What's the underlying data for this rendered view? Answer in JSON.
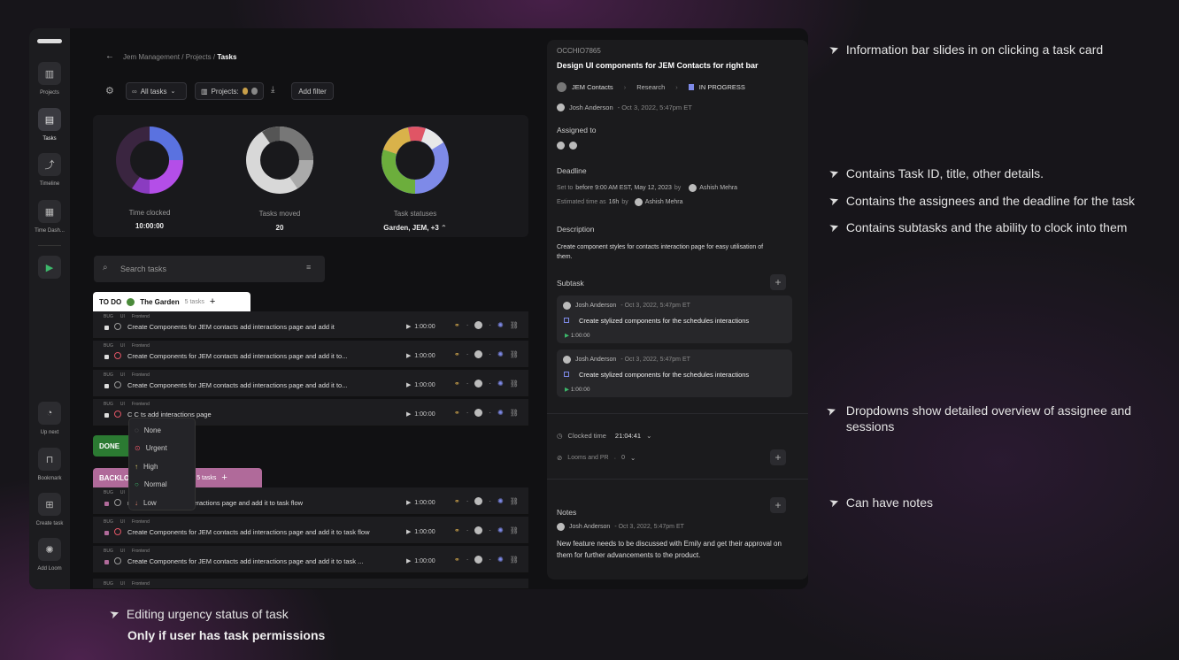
{
  "sidebar": {
    "items": [
      {
        "label": "Projects"
      },
      {
        "label": "Tasks"
      },
      {
        "label": "Timeline"
      },
      {
        "label": "Time Dash..."
      },
      {
        "label": "Up next"
      },
      {
        "label": "Bookmark"
      },
      {
        "label": "Create task"
      },
      {
        "label": "Add Loom"
      }
    ]
  },
  "breadcrumb": {
    "a": "Jem Management",
    "sep": "/",
    "b": "Projects",
    "c": "Tasks"
  },
  "toolbar": {
    "all_tasks": "All tasks",
    "projects": "Projects:",
    "add_filter": "Add filter"
  },
  "stats": [
    {
      "label": "Time clocked",
      "value": "10:00:00"
    },
    {
      "label": "Tasks moved",
      "value": "20"
    },
    {
      "label": "Task statuses",
      "value": "Garden, JEM, +3"
    }
  ],
  "search": {
    "placeholder": "Search tasks"
  },
  "groups": {
    "todo": {
      "status": "TO DO",
      "project": "The Garden",
      "count": "5 tasks"
    },
    "done": {
      "status": "DONE"
    },
    "backlog": {
      "status": "BACKLO",
      "project": "a",
      "count": "5 tasks"
    }
  },
  "tags": {
    "bug": "BUG",
    "ui": "UI",
    "frontend": "Frontend"
  },
  "tasks": [
    {
      "title": "Create Components for JEM contacts add interactions page and add it",
      "time": "1:00:00"
    },
    {
      "title": "Create Components for JEM contacts add interactions page and add it to...",
      "time": "1:00:00"
    },
    {
      "title": "Create Components for JEM contacts add interactions page and add it to...",
      "time": "1:00:00"
    },
    {
      "title": "C   C             ts add interactions page",
      "time": "1:00:00"
    },
    {
      "title": "r JEM contacts add interactions page and add it to task flow",
      "time": "1:00:00"
    },
    {
      "title": "Create Components for JEM contacts add interactions page and add it to task flow",
      "time": "1:00:00"
    },
    {
      "title": "Create Components for JEM contacts add interactions page and add it to task ...",
      "time": "1:00:00"
    }
  ],
  "urgency": {
    "options": [
      "None",
      "Urgent",
      "High",
      "Normal",
      "Low"
    ],
    "colors": [
      "#888888",
      "#e05565",
      "#d8c86a",
      "#3db86b",
      "#d8806a"
    ]
  },
  "panel": {
    "task_id": "OCCHIO7865",
    "title": "Design UI components for JEM Contacts for right bar",
    "project": "JEM Contacts",
    "list": "Research",
    "status": "IN PROGRESS",
    "creator": "Josh Anderson",
    "created": "- Oct 3, 2022, 5:47pm ET",
    "assigned_label": "Assigned to",
    "deadline_label": "Deadline",
    "deadline_prefix": "Set to",
    "deadline_value": "before 9:00 AM EST, May 12, 2023",
    "by": "by",
    "deadline_person": "Ashish Mehra",
    "estimate_prefix": "Estimated time as",
    "estimate_value": "16h",
    "description_label": "Description",
    "description": "Create component styles for contacts interaction page for easy utilisation of them.",
    "subtask_label": "Subtask",
    "subtasks": [
      {
        "author": "Josh Anderson",
        "date": "- Oct 3, 2022, 5:47pm ET",
        "title": "Create stylized components for the schedules interactions",
        "time": "1:00:00"
      },
      {
        "author": "Josh Anderson",
        "date": "- Oct 3, 2022, 5:47pm ET",
        "title": "Create stylized components for the schedules interactions",
        "time": "1:00:00"
      }
    ],
    "clocked_label": "Clocked time",
    "clocked_value": "21:04:41",
    "looms_label": "Looms and PR",
    "looms_value": "0",
    "notes_label": "Notes",
    "note_author": "Josh Anderson",
    "note_date": "- Oct 3, 2022, 5:47pm ET",
    "note_text": "New feature needs to be discussed with Emily and get their approval on them for further advancements to the product."
  },
  "annotations": [
    "Information bar slides in on clicking a task card",
    "Contains Task ID, title, other details.",
    "Contains the assignees and the deadline for the task",
    "Contains subtasks and the ability to clock into them",
    "Dropdowns show detailed overview of assignee and sessions",
    "Can have notes"
  ],
  "caption": {
    "line1": "Editing urgency status of task",
    "line2": "Only if user has task permissions"
  }
}
